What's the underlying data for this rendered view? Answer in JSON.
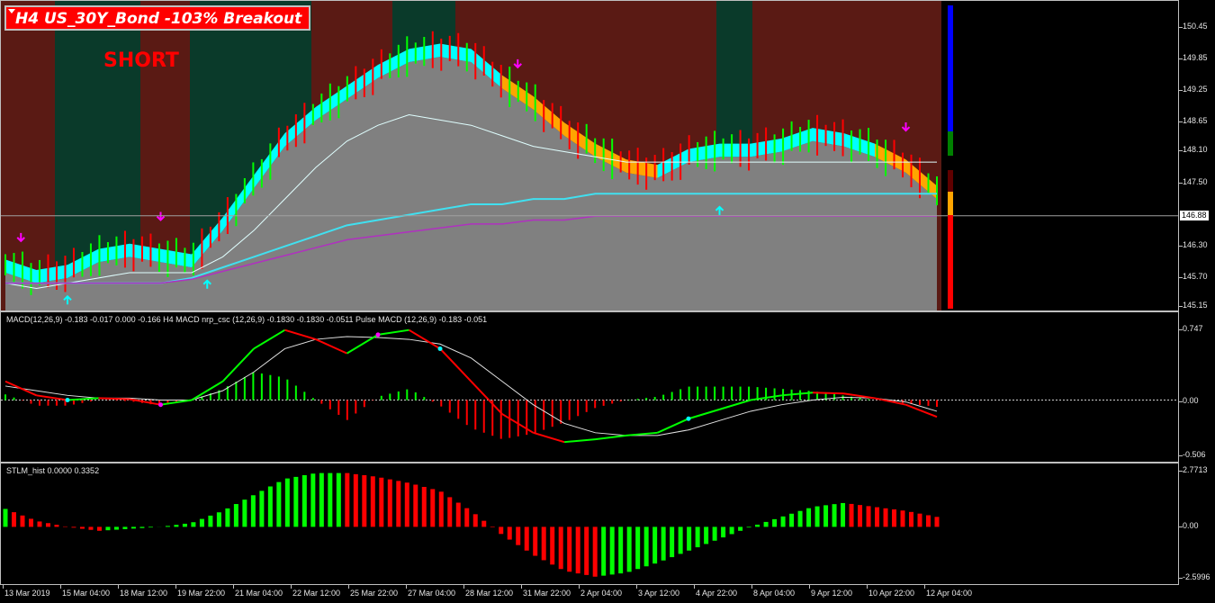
{
  "title": "H4 US_30Y_Bond  -103% Breakout",
  "signal": "SHORT",
  "colors": {
    "background": "#000000",
    "bull_candle": "#00ff00",
    "bear_candle": "#ff0000",
    "band_cyan": "#00ffff",
    "band_orange": "#ffa500",
    "ma_cyan": "#40e0f0",
    "ma_magenta": "#b030c0",
    "bg_red": "#5a1a14",
    "bg_green": "#0a3a2a",
    "fill_gray": "#808080"
  },
  "price_axis": {
    "labels": [
      "150.45",
      "149.85",
      "149.25",
      "148.65",
      "148.10",
      "147.50",
      "146.88",
      "146.30",
      "145.70",
      "145.15"
    ],
    "current_price": "146.88"
  },
  "macd_panel": {
    "label": "MACD(12,26,9) -0.183 -0.017 0.000 -0.166  H4 MACD nrp_csc (12,26,9) -0.1830 -0.1830 -0.0511  Pulse MACD (12,26,9) -0.183 -0.051",
    "axis_labels": [
      "0.747",
      "0.00",
      "-0.506"
    ]
  },
  "stlm_panel": {
    "label": "STLM_hist 0.0000 0.3352",
    "axis_labels": [
      "2.7713",
      "0.00",
      "-2.5996"
    ]
  },
  "time_labels": [
    "13 Mar 2019",
    "15 Mar 04:00",
    "18 Mar 12:00",
    "19 Mar 22:00",
    "21 Mar 04:00",
    "22 Mar 12:00",
    "25 Mar 22:00",
    "27 Mar 04:00",
    "28 Mar 12:00",
    "31 Mar 22:00",
    "2 Apr 04:00",
    "3 Apr 12:00",
    "4 Apr 22:00",
    "8 Apr 04:00",
    "9 Apr 12:00",
    "10 Apr 22:00",
    "12 Apr 04:00"
  ],
  "chart_data": [
    {
      "type": "line",
      "title": "H4 US_30Y_Bond  -103% Breakout",
      "ylim": [
        145.15,
        150.45
      ],
      "series": [
        {
          "values": [
            145.8,
            145.6,
            145.7,
            146.0,
            146.1,
            146.0,
            145.9,
            146.6,
            147.4,
            148.2,
            148.7,
            149.1,
            149.5,
            149.8,
            149.9,
            149.8,
            149.3,
            148.9,
            148.4,
            148.0,
            147.7,
            147.6,
            147.9,
            148.0,
            148.0,
            148.1,
            148.3,
            148.2,
            148.0,
            147.7,
            147.2
          ]
        },
        {
          "values": [
            145.6,
            145.5,
            145.6,
            145.7,
            145.8,
            145.8,
            145.8,
            146.1,
            146.6,
            147.2,
            147.8,
            148.3,
            148.6,
            148.8,
            148.7,
            148.6,
            148.4,
            148.2,
            148.1,
            148.0,
            147.9,
            147.9,
            147.9,
            147.9,
            147.9,
            147.9,
            147.9,
            147.9,
            147.9,
            147.9,
            147.9
          ]
        },
        {
          "values": [
            145.6,
            145.6,
            145.6,
            145.6,
            145.6,
            145.6,
            145.7,
            145.9,
            146.1,
            146.3,
            146.5,
            146.7,
            146.8,
            146.9,
            147.0,
            147.1,
            147.1,
            147.2,
            147.2,
            147.3,
            147.3,
            147.3,
            147.3,
            147.3,
            147.3,
            147.3,
            147.3,
            147.3,
            147.3,
            147.3,
            147.3
          ]
        }
      ],
      "current_price": 146.88
    },
    {
      "type": "line",
      "title": "MACD(12,26,9) -0.183 -0.017 0.000 -0.166  H4 MACD nrp_csc (12,26,9) -0.1830 -0.1830 -0.0511  Pulse MACD (12,26,9) -0.183 -0.051",
      "ylim": [
        -0.506,
        0.747
      ],
      "series": [
        {
          "values": [
            0.2,
            0.05,
            0.0,
            0.02,
            0.01,
            -0.05,
            0.0,
            0.2,
            0.55,
            0.75,
            0.65,
            0.5,
            0.7,
            0.75,
            0.55,
            0.2,
            -0.15,
            -0.35,
            -0.45,
            -0.42,
            -0.38,
            -0.35,
            -0.2,
            -0.1,
            0.0,
            0.05,
            0.08,
            0.07,
            0.02,
            -0.05,
            -0.18
          ]
        },
        {
          "values": [
            0.15,
            0.1,
            0.05,
            0.02,
            0.02,
            0.0,
            0.0,
            0.1,
            0.3,
            0.55,
            0.65,
            0.68,
            0.67,
            0.65,
            0.6,
            0.45,
            0.2,
            -0.05,
            -0.25,
            -0.35,
            -0.38,
            -0.38,
            -0.32,
            -0.22,
            -0.12,
            -0.05,
            0.0,
            0.03,
            0.02,
            -0.02,
            -0.12
          ]
        }
      ]
    },
    {
      "type": "bar",
      "title": "STLM_hist 0.0000 0.3352",
      "ylim": [
        -2.5996,
        2.7713
      ],
      "values": [
        0.9,
        0.3,
        0.0,
        -0.2,
        -0.1,
        0.0,
        0.2,
        0.8,
        1.6,
        2.4,
        2.7,
        2.7,
        2.5,
        2.2,
        1.8,
        0.8,
        -0.4,
        -1.4,
        -2.2,
        -2.5,
        -2.3,
        -1.8,
        -1.2,
        -0.6,
        0.0,
        0.5,
        1.0,
        1.2,
        1.0,
        0.8,
        0.5
      ]
    }
  ]
}
